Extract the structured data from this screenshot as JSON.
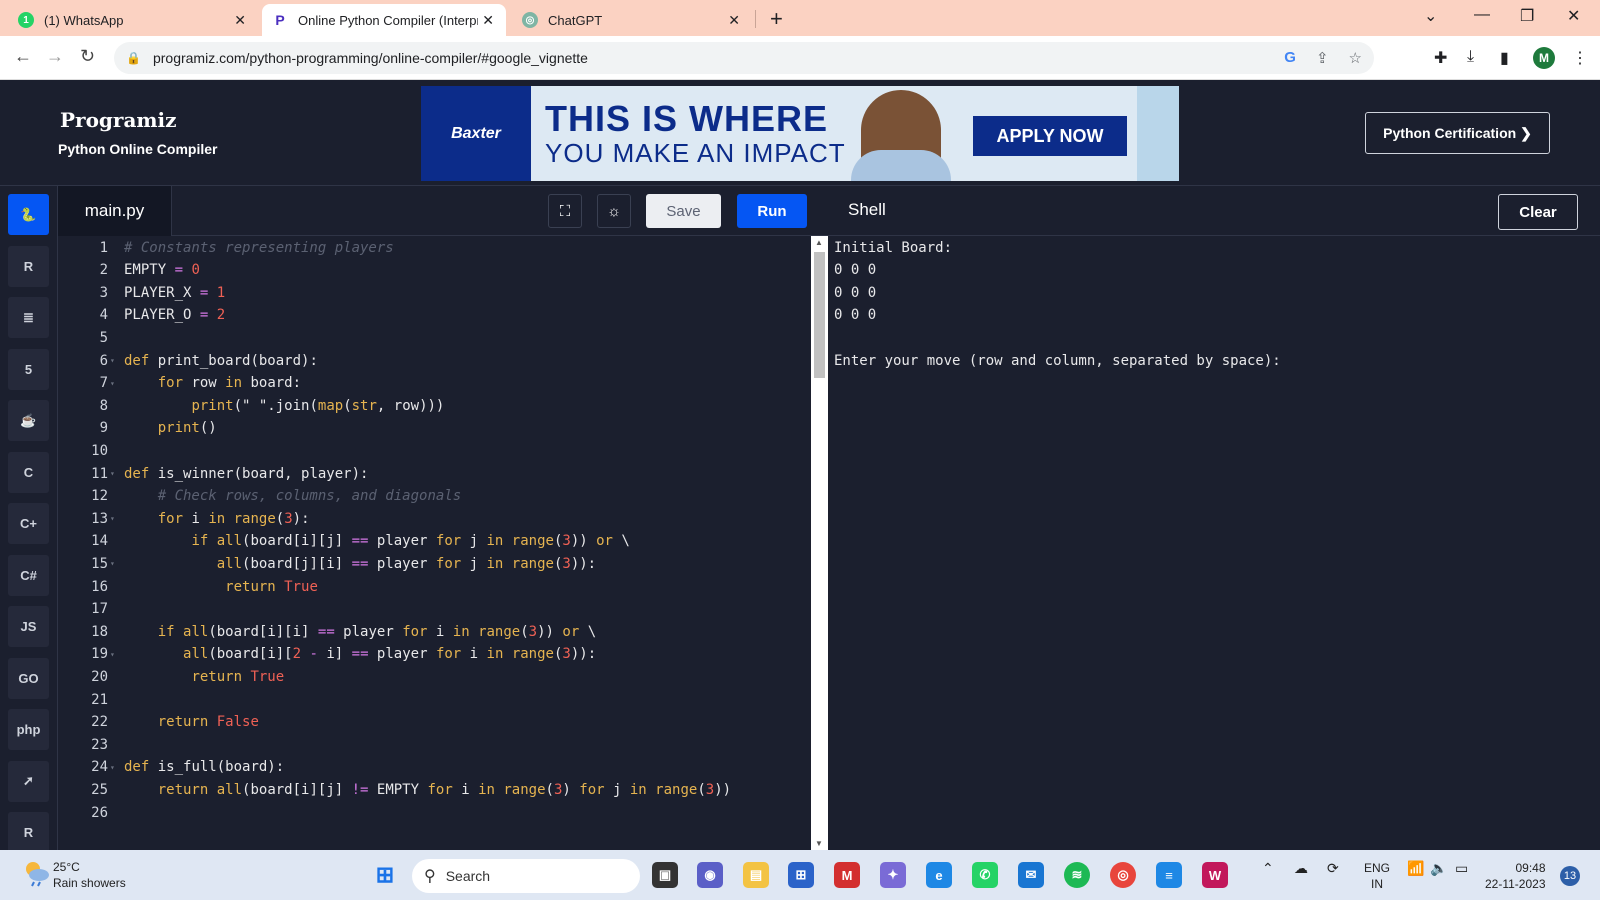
{
  "browser": {
    "tabs": [
      {
        "label": "(1) WhatsApp",
        "icon": "whatsapp-icon",
        "active": false
      },
      {
        "label": "Online Python Compiler (Interpr",
        "icon": "programiz-icon",
        "active": true
      },
      {
        "label": "ChatGPT",
        "icon": "chatgpt-icon",
        "active": false
      }
    ],
    "url": "programiz.com/python-programming/online-compiler/#google_vignette",
    "profile_initial": "M"
  },
  "site": {
    "logo": "Programiz",
    "subtitle": "Python Online Compiler",
    "certification_button": "Python Certification ❯",
    "ad": {
      "brand": "Baxter",
      "headline": "THIS IS WHERE",
      "subheadline": "YOU MAKE AN IMPACT",
      "cta": "APPLY NOW"
    }
  },
  "sidebar": {
    "languages": [
      {
        "name": "python",
        "glyph": "🐍",
        "active": true
      },
      {
        "name": "r",
        "glyph": "R"
      },
      {
        "name": "sql",
        "glyph": "≣"
      },
      {
        "name": "html",
        "glyph": "5"
      },
      {
        "name": "java",
        "glyph": "☕"
      },
      {
        "name": "c",
        "glyph": "C"
      },
      {
        "name": "cpp",
        "glyph": "C+"
      },
      {
        "name": "csharp",
        "glyph": "C#"
      },
      {
        "name": "js",
        "glyph": "JS"
      },
      {
        "name": "go",
        "glyph": "GO"
      },
      {
        "name": "php",
        "glyph": "php"
      },
      {
        "name": "swift",
        "glyph": "➚"
      },
      {
        "name": "rust",
        "glyph": "R"
      }
    ]
  },
  "editor": {
    "filename": "main.py",
    "save_label": "Save",
    "run_label": "Run",
    "fullscreen_icon": "fullscreen-icon",
    "theme_icon": "sun-icon",
    "lines": [
      {
        "n": "1",
        "fold": false,
        "tokens": [
          [
            "cm",
            "# Constants representing players"
          ]
        ]
      },
      {
        "n": "2",
        "fold": false,
        "tokens": [
          [
            "fn",
            "EMPTY "
          ],
          [
            "op",
            "="
          ],
          [
            "fn",
            " "
          ],
          [
            "num",
            "0"
          ]
        ]
      },
      {
        "n": "3",
        "fold": false,
        "tokens": [
          [
            "fn",
            "PLAYER_X "
          ],
          [
            "op",
            "="
          ],
          [
            "fn",
            " "
          ],
          [
            "num",
            "1"
          ]
        ]
      },
      {
        "n": "4",
        "fold": false,
        "tokens": [
          [
            "fn",
            "PLAYER_O "
          ],
          [
            "op",
            "="
          ],
          [
            "fn",
            " "
          ],
          [
            "num",
            "2"
          ]
        ]
      },
      {
        "n": "5",
        "fold": false,
        "tokens": []
      },
      {
        "n": "6",
        "fold": true,
        "tokens": [
          [
            "kw",
            "def"
          ],
          [
            "fn",
            " print_board(board):"
          ]
        ]
      },
      {
        "n": "7",
        "fold": true,
        "tokens": [
          [
            "fn",
            "    "
          ],
          [
            "kw",
            "for"
          ],
          [
            "fn",
            " row "
          ],
          [
            "kw",
            "in"
          ],
          [
            "fn",
            " board:"
          ]
        ]
      },
      {
        "n": "8",
        "fold": false,
        "tokens": [
          [
            "fn",
            "        "
          ],
          [
            "kw",
            "print"
          ],
          [
            "fn",
            "(\" \".join("
          ],
          [
            "kw",
            "map"
          ],
          [
            "fn",
            "("
          ],
          [
            "kw",
            "str"
          ],
          [
            "fn",
            ", row)))"
          ]
        ]
      },
      {
        "n": "9",
        "fold": false,
        "tokens": [
          [
            "fn",
            "    "
          ],
          [
            "kw",
            "print"
          ],
          [
            "fn",
            "()"
          ]
        ]
      },
      {
        "n": "10",
        "fold": false,
        "tokens": []
      },
      {
        "n": "11",
        "fold": true,
        "tokens": [
          [
            "kw",
            "def"
          ],
          [
            "fn",
            " is_winner(board, player):"
          ]
        ]
      },
      {
        "n": "12",
        "fold": false,
        "tokens": [
          [
            "fn",
            "    "
          ],
          [
            "cm",
            "# Check rows, columns, and diagonals"
          ]
        ]
      },
      {
        "n": "13",
        "fold": true,
        "tokens": [
          [
            "fn",
            "    "
          ],
          [
            "kw",
            "for"
          ],
          [
            "fn",
            " i "
          ],
          [
            "kw",
            "in"
          ],
          [
            "fn",
            " "
          ],
          [
            "kw",
            "range"
          ],
          [
            "fn",
            "("
          ],
          [
            "num",
            "3"
          ],
          [
            "fn",
            "):"
          ]
        ]
      },
      {
        "n": "14",
        "fold": false,
        "tokens": [
          [
            "fn",
            "        "
          ],
          [
            "kw",
            "if"
          ],
          [
            "fn",
            " "
          ],
          [
            "kw",
            "all"
          ],
          [
            "fn",
            "(board[i][j] "
          ],
          [
            "op",
            "=="
          ],
          [
            "fn",
            " player "
          ],
          [
            "kw",
            "for"
          ],
          [
            "fn",
            " j "
          ],
          [
            "kw",
            "in"
          ],
          [
            "fn",
            " "
          ],
          [
            "kw",
            "range"
          ],
          [
            "fn",
            "("
          ],
          [
            "num",
            "3"
          ],
          [
            "fn",
            ")) "
          ],
          [
            "kw",
            "or"
          ],
          [
            "fn",
            " \\"
          ]
        ]
      },
      {
        "n": "15",
        "fold": true,
        "tokens": [
          [
            "fn",
            "           "
          ],
          [
            "kw",
            "all"
          ],
          [
            "fn",
            "(board[j][i] "
          ],
          [
            "op",
            "=="
          ],
          [
            "fn",
            " player "
          ],
          [
            "kw",
            "for"
          ],
          [
            "fn",
            " j "
          ],
          [
            "kw",
            "in"
          ],
          [
            "fn",
            " "
          ],
          [
            "kw",
            "range"
          ],
          [
            "fn",
            "("
          ],
          [
            "num",
            "3"
          ],
          [
            "fn",
            ")):"
          ]
        ]
      },
      {
        "n": "16",
        "fold": false,
        "tokens": [
          [
            "fn",
            "            "
          ],
          [
            "kw",
            "return"
          ],
          [
            "fn",
            " "
          ],
          [
            "num",
            "True"
          ]
        ]
      },
      {
        "n": "17",
        "fold": false,
        "tokens": []
      },
      {
        "n": "18",
        "fold": false,
        "tokens": [
          [
            "fn",
            "    "
          ],
          [
            "kw",
            "if"
          ],
          [
            "fn",
            " "
          ],
          [
            "kw",
            "all"
          ],
          [
            "fn",
            "(board[i][i] "
          ],
          [
            "op",
            "=="
          ],
          [
            "fn",
            " player "
          ],
          [
            "kw",
            "for"
          ],
          [
            "fn",
            " i "
          ],
          [
            "kw",
            "in"
          ],
          [
            "fn",
            " "
          ],
          [
            "kw",
            "range"
          ],
          [
            "fn",
            "("
          ],
          [
            "num",
            "3"
          ],
          [
            "fn",
            ")) "
          ],
          [
            "kw",
            "or"
          ],
          [
            "fn",
            " \\"
          ]
        ]
      },
      {
        "n": "19",
        "fold": true,
        "tokens": [
          [
            "fn",
            "       "
          ],
          [
            "kw",
            "all"
          ],
          [
            "fn",
            "(board[i]["
          ],
          [
            "num",
            "2"
          ],
          [
            "fn",
            " "
          ],
          [
            "op",
            "-"
          ],
          [
            "fn",
            " i] "
          ],
          [
            "op",
            "=="
          ],
          [
            "fn",
            " player "
          ],
          [
            "kw",
            "for"
          ],
          [
            "fn",
            " i "
          ],
          [
            "kw",
            "in"
          ],
          [
            "fn",
            " "
          ],
          [
            "kw",
            "range"
          ],
          [
            "fn",
            "("
          ],
          [
            "num",
            "3"
          ],
          [
            "fn",
            ")):"
          ]
        ]
      },
      {
        "n": "20",
        "fold": false,
        "tokens": [
          [
            "fn",
            "        "
          ],
          [
            "kw",
            "return"
          ],
          [
            "fn",
            " "
          ],
          [
            "num",
            "True"
          ]
        ]
      },
      {
        "n": "21",
        "fold": false,
        "tokens": []
      },
      {
        "n": "22",
        "fold": false,
        "tokens": [
          [
            "fn",
            "    "
          ],
          [
            "kw",
            "return"
          ],
          [
            "fn",
            " "
          ],
          [
            "num",
            "False"
          ]
        ]
      },
      {
        "n": "23",
        "fold": false,
        "tokens": []
      },
      {
        "n": "24",
        "fold": true,
        "tokens": [
          [
            "kw",
            "def"
          ],
          [
            "fn",
            " is_full(board):"
          ]
        ]
      },
      {
        "n": "25",
        "fold": false,
        "tokens": [
          [
            "fn",
            "    "
          ],
          [
            "kw",
            "return"
          ],
          [
            "fn",
            " "
          ],
          [
            "kw",
            "all"
          ],
          [
            "fn",
            "(board[i][j] "
          ],
          [
            "op",
            "!="
          ],
          [
            "fn",
            " EMPTY "
          ],
          [
            "kw",
            "for"
          ],
          [
            "fn",
            " i "
          ],
          [
            "kw",
            "in"
          ],
          [
            "fn",
            " "
          ],
          [
            "kw",
            "range"
          ],
          [
            "fn",
            "("
          ],
          [
            "num",
            "3"
          ],
          [
            "fn",
            ") "
          ],
          [
            "kw",
            "for"
          ],
          [
            "fn",
            " j "
          ],
          [
            "kw",
            "in"
          ],
          [
            "fn",
            " "
          ],
          [
            "kw",
            "range"
          ],
          [
            "fn",
            "("
          ],
          [
            "num",
            "3"
          ],
          [
            "fn",
            "))"
          ]
        ]
      },
      {
        "n": "26",
        "fold": false,
        "tokens": []
      }
    ]
  },
  "shell": {
    "title": "Shell",
    "clear_label": "Clear",
    "output": [
      "Initial Board:",
      "0 0 0",
      "0 0 0",
      "0 0 0",
      "",
      "Enter your move (row and column, separated by space):"
    ]
  },
  "taskbar": {
    "weather_temp": "25°C",
    "weather_desc": "Rain showers",
    "search_placeholder": "Search",
    "language": "ENG",
    "region": "IN",
    "time": "09:48",
    "date": "22-11-2023",
    "notification_count": "13"
  }
}
